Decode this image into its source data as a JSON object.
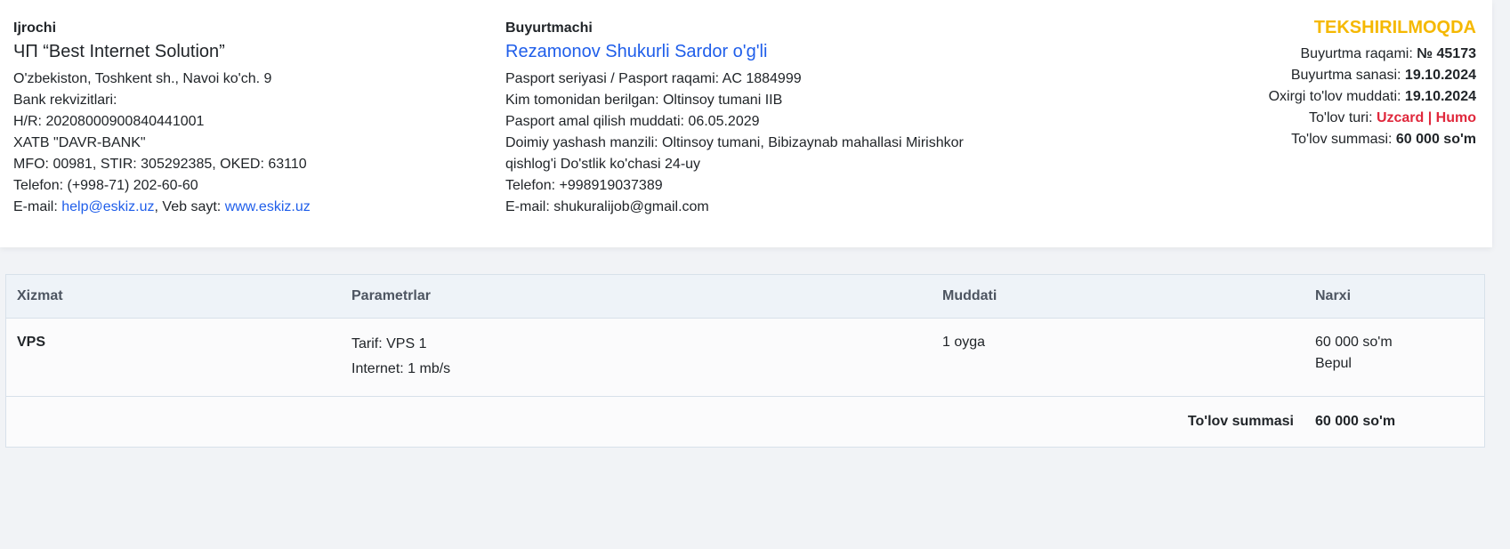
{
  "executor": {
    "heading": "Ijrochi",
    "name": "ЧП “Best Internet Solution”",
    "address": "O'zbekiston, Toshkent sh., Navoi ko'ch. 9",
    "bank_label": "Bank rekvizitlari:",
    "account": "H/R: 20208000900840441001",
    "bank_name": "XATB \"DAVR-BANK\"",
    "codes": "MFO: 00981, STIR: 305292385, OKED: 63110",
    "phone": "Telefon: (+998-71) 202-60-60",
    "email_prefix": "E-mail: ",
    "email": "help@eskiz.uz",
    "site_prefix": ", Veb sayt: ",
    "site": "www.eskiz.uz"
  },
  "customer": {
    "heading": "Buyurtmachi",
    "name": "Rezamonov Shukurli Sardor o'g'li",
    "passport": "Pasport seriyasi / Pasport raqami: AC 1884999",
    "issued_by": "Kim tomonidan berilgan: Oltinsoy tumani IIB",
    "valid_until": "Pasport amal qilish muddati: 06.05.2029",
    "address_line1": "Doimiy yashash manzili: Oltinsoy tumani, Bibizaynab mahallasi Mirishkor",
    "address_line2": "qishlog'i Do'stlik ko'chasi 24-uy",
    "phone": "Telefon: +998919037389",
    "email": "E-mail: shukuralijob@gmail.com"
  },
  "order": {
    "status": "TEKSHIRILMOQDA",
    "number_label": "Buyurtma raqami: ",
    "number_value": "№ 45173",
    "date_label": "Buyurtma sanasi: ",
    "date_value": "19.10.2024",
    "deadline_label": "Oxirgi to'lov muddati: ",
    "deadline_value": "19.10.2024",
    "pay_type_label": "To'lov turi: ",
    "pay_type_value": "Uzcard | Humo",
    "total_label": "To'lov summasi: ",
    "total_value": "60 000 so'm",
    "colors": {
      "status": "#f5b800",
      "pay_types": "#e0283c",
      "link": "#1f5eea"
    }
  },
  "table": {
    "headers": [
      "Xizmat",
      "Parametrlar",
      "Muddati",
      "Narxi"
    ],
    "rows": [
      {
        "service": "VPS",
        "params": [
          "Tarif: VPS 1",
          "Internet: 1 mb/s"
        ],
        "duration": "1 oyga",
        "price": [
          "60 000 so'm",
          "Bepul"
        ]
      }
    ],
    "total_label": "To'lov summasi",
    "total_value": "60 000 so'm"
  }
}
